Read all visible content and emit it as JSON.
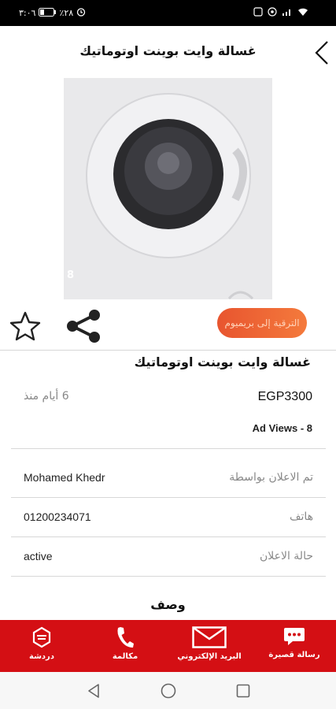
{
  "status_bar": {
    "time": "٣:٠٦",
    "battery": "٪٢٨"
  },
  "header": {
    "title": "غسالة وايت بوينت اوتوماتيك"
  },
  "image": {
    "watermark": "8"
  },
  "actions": {
    "premium_label": "الترقية إلى بريميوم"
  },
  "ad": {
    "title": "غسالة وايت بوينت اوتوماتيك",
    "price": "EGP3300",
    "posted_ago": "6 أيام منذ",
    "views": "Ad Views - 8"
  },
  "details": [
    {
      "label": "تم الاعلان بواسطة",
      "value": "Mohamed Khedr"
    },
    {
      "label": "هاتف",
      "value": "01200234071"
    },
    {
      "label": "حالة الاعلان",
      "value": "active"
    }
  ],
  "description": {
    "heading": "وصف"
  },
  "bottom_bar": {
    "sms": "رسالة قصيرة",
    "email": "البريد الإلكتروني",
    "call": "مكالمة",
    "chat": "دردشة"
  },
  "colors": {
    "accent_red": "#d40f14",
    "premium_orange": "#f0663a"
  }
}
